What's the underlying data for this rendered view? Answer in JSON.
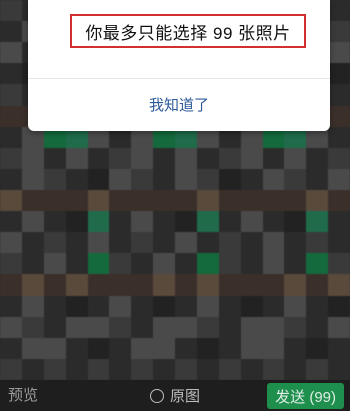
{
  "dialog": {
    "message": "你最多只能选择 99 张照片",
    "action_label": "我知道了"
  },
  "toolbar": {
    "preview_label": "预览",
    "original_label": "原图",
    "send_label": "发送 (99)"
  },
  "colors": {
    "highlight_border": "#d32f2f",
    "action_text": "#2d5a9a",
    "send_button": "#1f8f4e"
  }
}
